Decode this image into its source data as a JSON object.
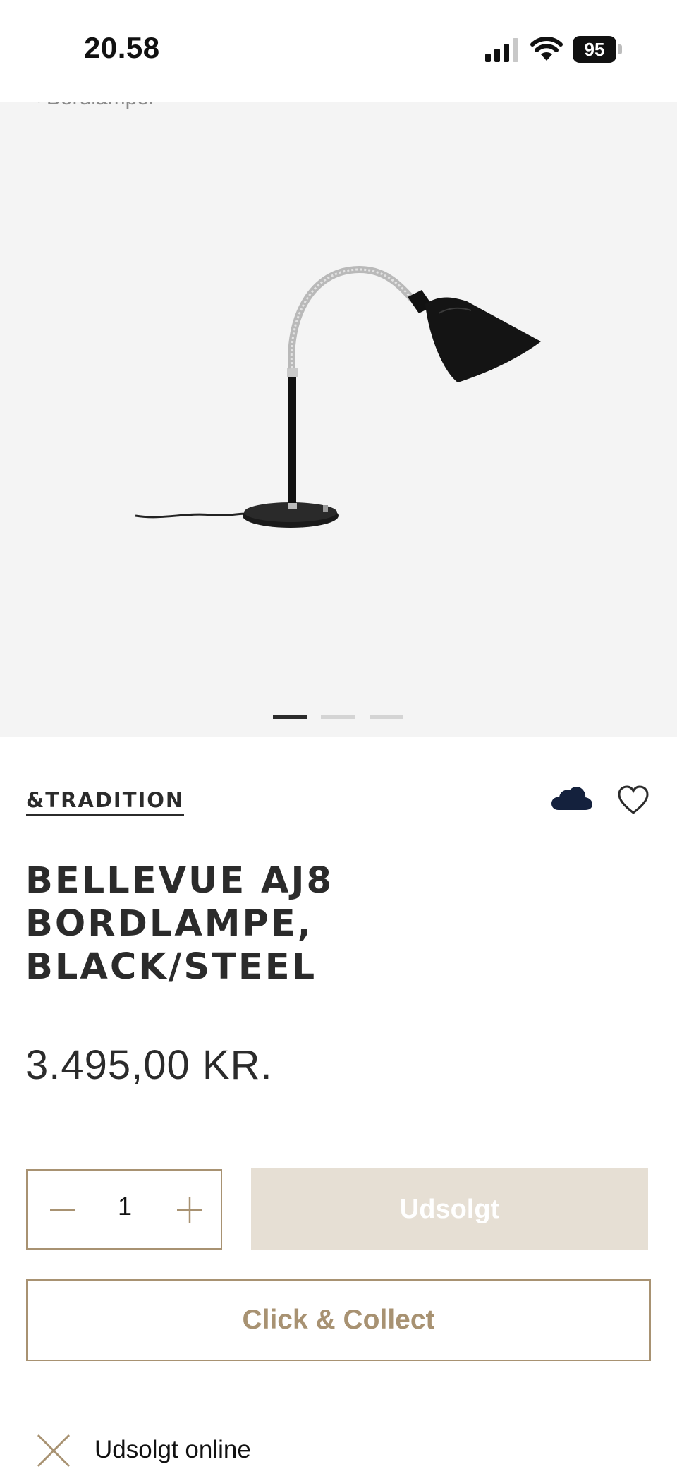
{
  "status_bar": {
    "time": "20.58",
    "battery": "95"
  },
  "breadcrumb": "< Bordlamper",
  "gallery": {
    "slide_count": 3,
    "active_index": 0
  },
  "product": {
    "brand": "&TRADITION",
    "title_lines": [
      "BELLEVUE AJ8",
      "BORDLAMPE,",
      "BLACK/STEEL"
    ],
    "price": "3.495,00 KR."
  },
  "quantity": {
    "minus": "−",
    "value": "1",
    "plus": "+"
  },
  "buttons": {
    "soldout": "Udsolgt",
    "click_collect": "Click & Collect"
  },
  "stock": {
    "status": "Udsolgt online"
  },
  "colors": {
    "accent": "#a89272",
    "disabled_fill": "#e6dfd4",
    "text": "#2b2b2b",
    "hero_bg": "#f4f4f4",
    "cloud": "#14213d"
  },
  "icons": [
    "cloud-icon",
    "heart-icon",
    "minus-icon",
    "plus-icon",
    "x-icon",
    "signal-icon",
    "wifi-icon",
    "battery-icon"
  ]
}
